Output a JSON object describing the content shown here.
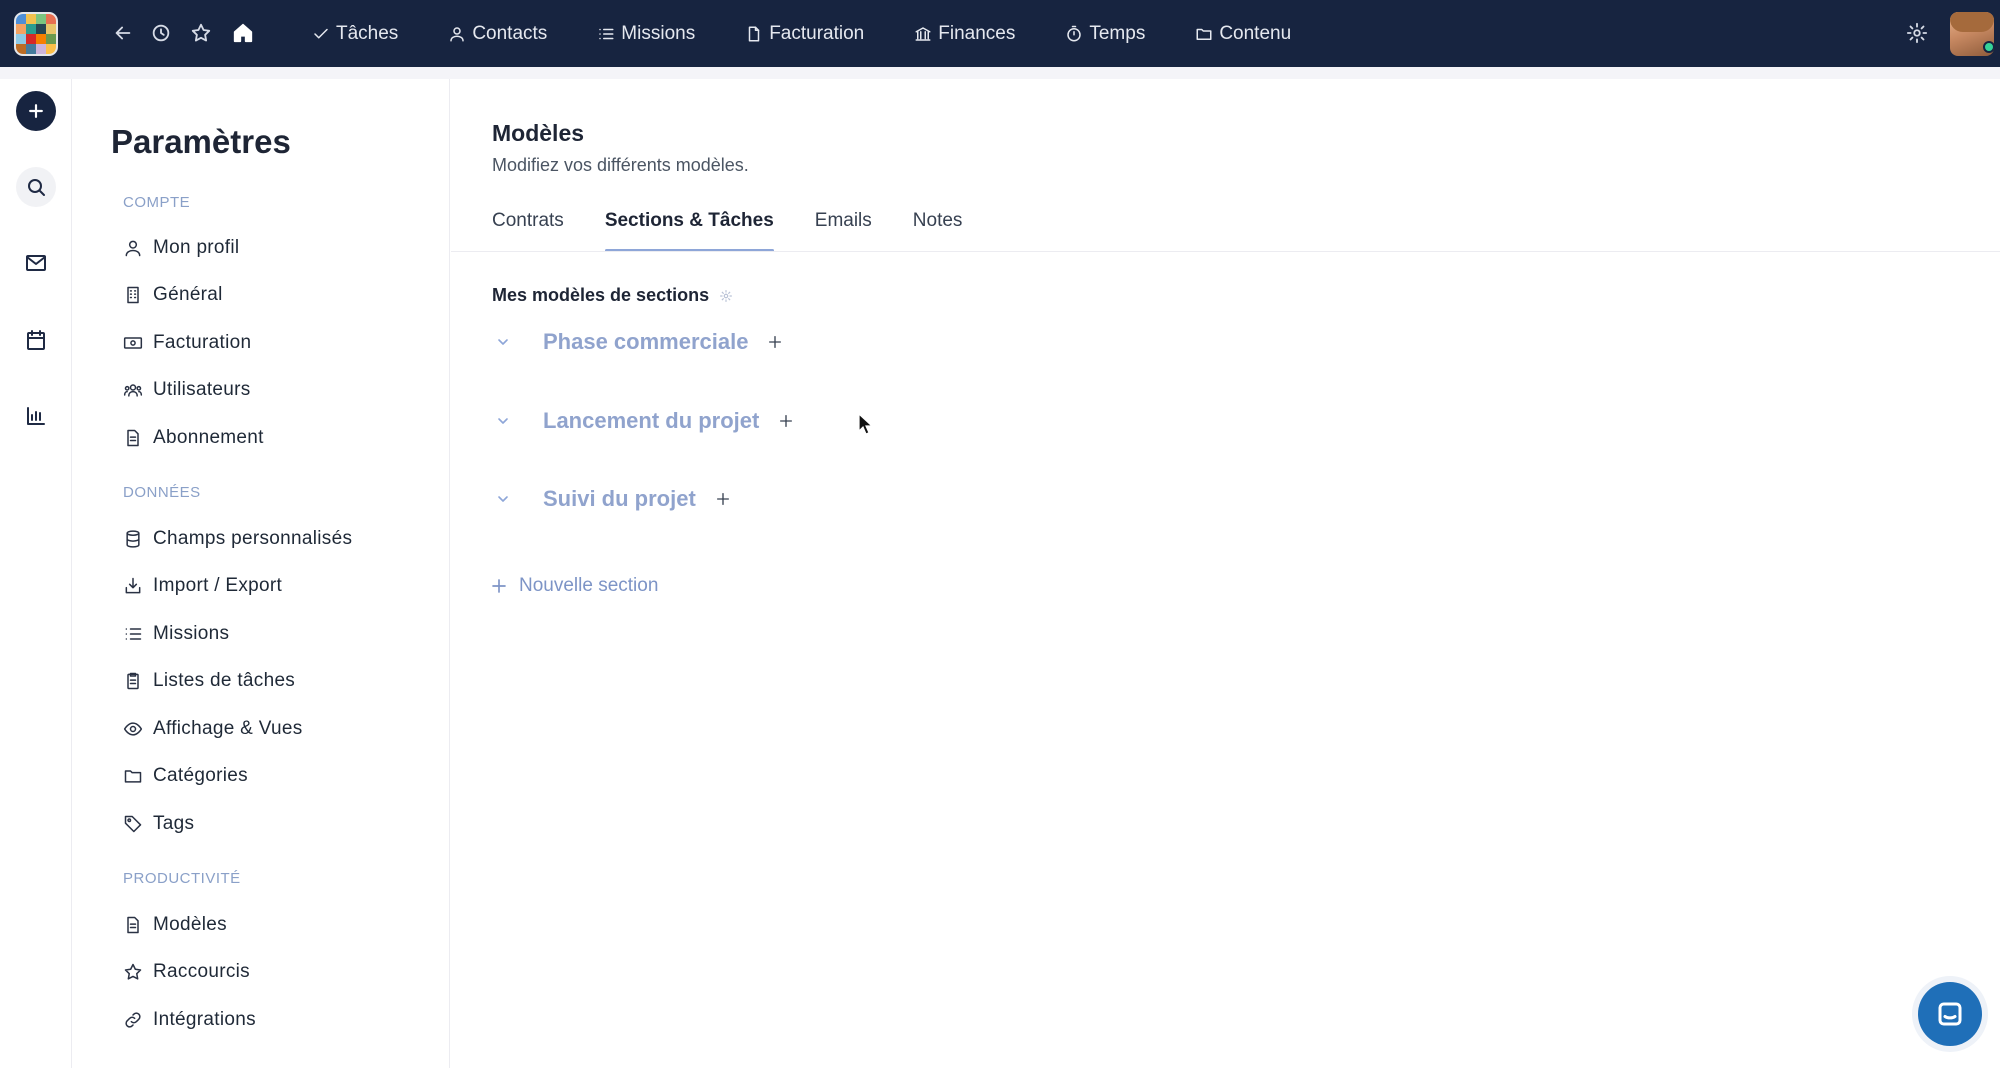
{
  "topbar": {
    "nav": [
      {
        "label": "Tâches",
        "icon": "check-icon"
      },
      {
        "label": "Contacts",
        "icon": "user-icon"
      },
      {
        "label": "Missions",
        "icon": "list-icon"
      },
      {
        "label": "Facturation",
        "icon": "document-icon"
      },
      {
        "label": "Finances",
        "icon": "bank-icon"
      },
      {
        "label": "Temps",
        "icon": "stopwatch-icon"
      },
      {
        "label": "Contenu",
        "icon": "folder-icon"
      }
    ],
    "icons": [
      "back-arrow-icon",
      "history-icon",
      "star-icon",
      "home-icon",
      "gear-icon"
    ]
  },
  "rail": {
    "icons": [
      "plus-icon",
      "search-icon",
      "mail-icon",
      "calendar-icon",
      "bar-chart-icon"
    ]
  },
  "settings": {
    "title": "Paramètres",
    "groups": [
      {
        "label": "COMPTE",
        "items": [
          {
            "label": "Mon profil",
            "icon": "user-icon"
          },
          {
            "label": "Général",
            "icon": "building-icon"
          },
          {
            "label": "Facturation",
            "icon": "banknote-icon"
          },
          {
            "label": "Utilisateurs",
            "icon": "users-icon"
          },
          {
            "label": "Abonnement",
            "icon": "receipt-icon"
          }
        ]
      },
      {
        "label": "DONNÉES",
        "items": [
          {
            "label": "Champs personnalisés",
            "icon": "database-icon"
          },
          {
            "label": "Import / Export",
            "icon": "import-icon"
          },
          {
            "label": "Missions",
            "icon": "list-icon"
          },
          {
            "label": "Listes de tâches",
            "icon": "clipboard-icon"
          },
          {
            "label": "Affichage & Vues",
            "icon": "eye-icon"
          },
          {
            "label": "Catégories",
            "icon": "folder-icon"
          },
          {
            "label": "Tags",
            "icon": "tag-icon"
          }
        ]
      },
      {
        "label": "PRODUCTIVITÉ",
        "items": [
          {
            "label": "Modèles",
            "icon": "template-icon"
          },
          {
            "label": "Raccourcis",
            "icon": "star-icon"
          },
          {
            "label": "Intégrations",
            "icon": "link-icon"
          }
        ]
      }
    ]
  },
  "main": {
    "title": "Modèles",
    "subtitle": "Modifiez vos différents modèles.",
    "tabs": [
      "Contrats",
      "Sections & Tâches",
      "Emails",
      "Notes"
    ],
    "active_tab": "Sections & Tâches",
    "sections_title": "Mes modèles de sections",
    "sections": [
      "Phase commerciale",
      "Lancement du projet",
      "Suivi du projet"
    ],
    "new_section_label": "Nouvelle section"
  },
  "colors": {
    "topbar": "#172440",
    "accent": "#8ea6d8",
    "group_label": "#8aa0c8",
    "chat_button": "#1f6fb8"
  }
}
